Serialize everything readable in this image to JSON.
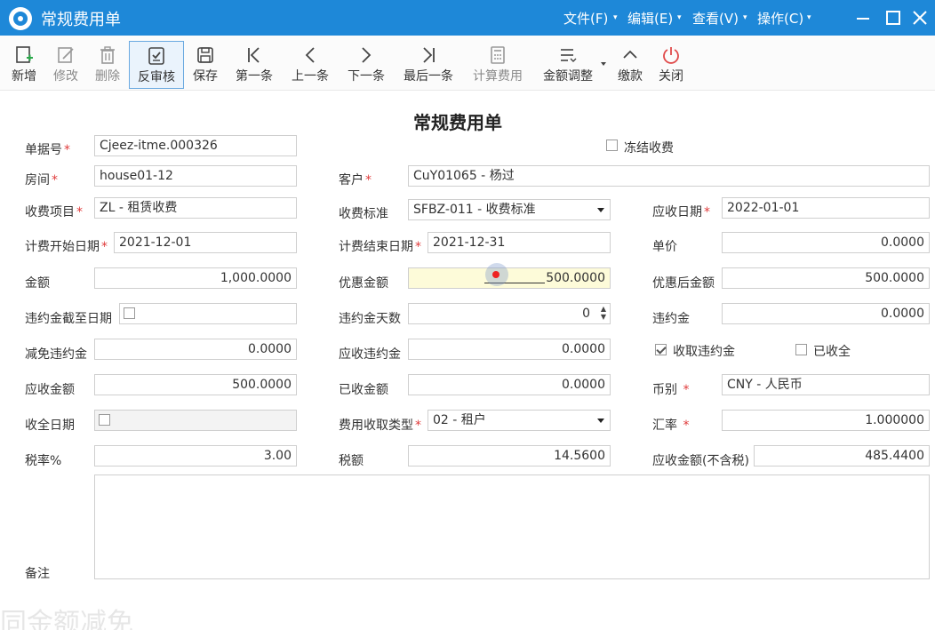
{
  "window": {
    "title": "常规费用单",
    "menus": [
      "文件(F)",
      "编辑(E)",
      "查看(V)",
      "操作(C)"
    ]
  },
  "toolbar": {
    "buttons": [
      {
        "label": "新增",
        "icon": "add-doc-icon",
        "enabled": true
      },
      {
        "label": "修改",
        "icon": "edit-icon",
        "enabled": false
      },
      {
        "label": "删除",
        "icon": "trash-icon",
        "enabled": false
      },
      {
        "label": "反审核",
        "icon": "unapprove-icon",
        "enabled": true
      },
      {
        "label": "保存",
        "icon": "save-icon",
        "enabled": true
      },
      {
        "label": "第一条",
        "icon": "first-record-icon",
        "enabled": true
      },
      {
        "label": "上一条",
        "icon": "prev-record-icon",
        "enabled": true
      },
      {
        "label": "下一条",
        "icon": "next-record-icon",
        "enabled": true
      },
      {
        "label": "最后一条",
        "icon": "last-record-icon",
        "enabled": true
      },
      {
        "label": "计算费用",
        "icon": "calculator-icon",
        "enabled": false
      },
      {
        "label": "金额调整",
        "icon": "adjust-icon",
        "enabled": true
      },
      {
        "label": "缴款",
        "icon": "pay-icon",
        "enabled": true
      },
      {
        "label": "关闭",
        "icon": "power-icon",
        "enabled": true
      }
    ]
  },
  "form": {
    "title": "常规费用单",
    "doc_no": {
      "label": "单据号",
      "value": "Cjeez-itme.000326"
    },
    "freeze": {
      "label": "冻结收费",
      "checked": false
    },
    "room": {
      "label": "房间",
      "value": "house01-12"
    },
    "customer": {
      "label": "客户",
      "value": "CuY01065 - 杨过"
    },
    "fee_item": {
      "label": "收费项目",
      "value": "ZL - 租赁收费"
    },
    "fee_standard": {
      "label": "收费标准",
      "value": "SFBZ-011 - 收费标准"
    },
    "due_date": {
      "label": "应收日期",
      "value": "2022-01-01"
    },
    "start_date": {
      "label": "计费开始日期",
      "value": "2021-12-01"
    },
    "end_date": {
      "label": "计费结束日期",
      "value": "2021-12-31"
    },
    "unit_price": {
      "label": "单价",
      "value": "0.0000"
    },
    "amount": {
      "label": "金额",
      "value": "1,000.0000"
    },
    "discount": {
      "label": "优惠金额",
      "value": "500.0000"
    },
    "after_discount": {
      "label": "优惠后金额",
      "value": "500.0000"
    },
    "penalty_cutoff": {
      "label": "违约金截至日期",
      "checked": false
    },
    "penalty_days": {
      "label": "违约金天数",
      "value": "0"
    },
    "penalty": {
      "label": "违约金",
      "value": "0.0000"
    },
    "penalty_waived": {
      "label": "减免违约金",
      "value": "0.0000"
    },
    "penalty_receivable": {
      "label": "应收违约金",
      "value": "0.0000"
    },
    "collect_penalty": {
      "label": "收取违约金",
      "checked": true
    },
    "fully_collected": {
      "label": "已收全",
      "checked": false
    },
    "receivable": {
      "label": "应收金额",
      "value": "500.0000"
    },
    "received": {
      "label": "已收金额",
      "value": "0.0000"
    },
    "currency": {
      "label": "币别",
      "value": "CNY - 人民币"
    },
    "full_date": {
      "label": "收全日期",
      "checked": false
    },
    "fee_type": {
      "label": "费用收取类型",
      "value": "02 - 租户"
    },
    "exchange_rate": {
      "label": "汇率",
      "value": "1.000000"
    },
    "tax_rate": {
      "label": "税率%",
      "value": "3.00"
    },
    "tax": {
      "label": "税额",
      "value": "14.5600"
    },
    "receivable_ex_tax": {
      "label": "应收金额(不含税)",
      "value": "485.4400"
    },
    "remark": {
      "label": "备注",
      "value": ""
    }
  },
  "watermark": "同金额减免"
}
